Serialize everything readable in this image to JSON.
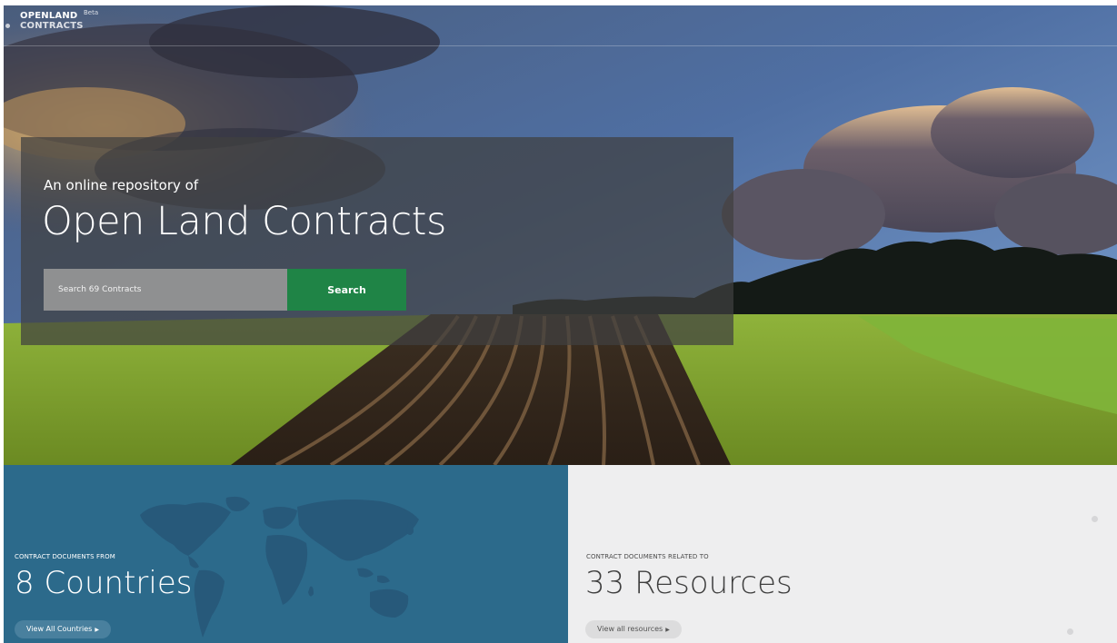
{
  "brand": {
    "line1": "OPENLAND",
    "beta": "Beta",
    "line2": "CONTRACTS"
  },
  "hero": {
    "subtitle": "An online repository of",
    "title": "Open Land Contracts",
    "search": {
      "placeholder": "Search 69 Contracts",
      "button_label": "Search"
    }
  },
  "cards": {
    "countries": {
      "eyebrow": "CONTRACT DOCUMENTS FROM",
      "big": "8 Countries",
      "link": "View All Countries"
    },
    "resources": {
      "eyebrow": "CONTRACT DOCUMENTS RELATED TO",
      "big": "33 Resources",
      "link": "View all resources"
    }
  },
  "icons": {
    "link_arrow": "arrow-right-icon",
    "map": "world-map-icon"
  },
  "colors": {
    "search_button": "#1f8446",
    "countries_card": "#2c6a8b",
    "resources_card": "#eeeeef"
  }
}
